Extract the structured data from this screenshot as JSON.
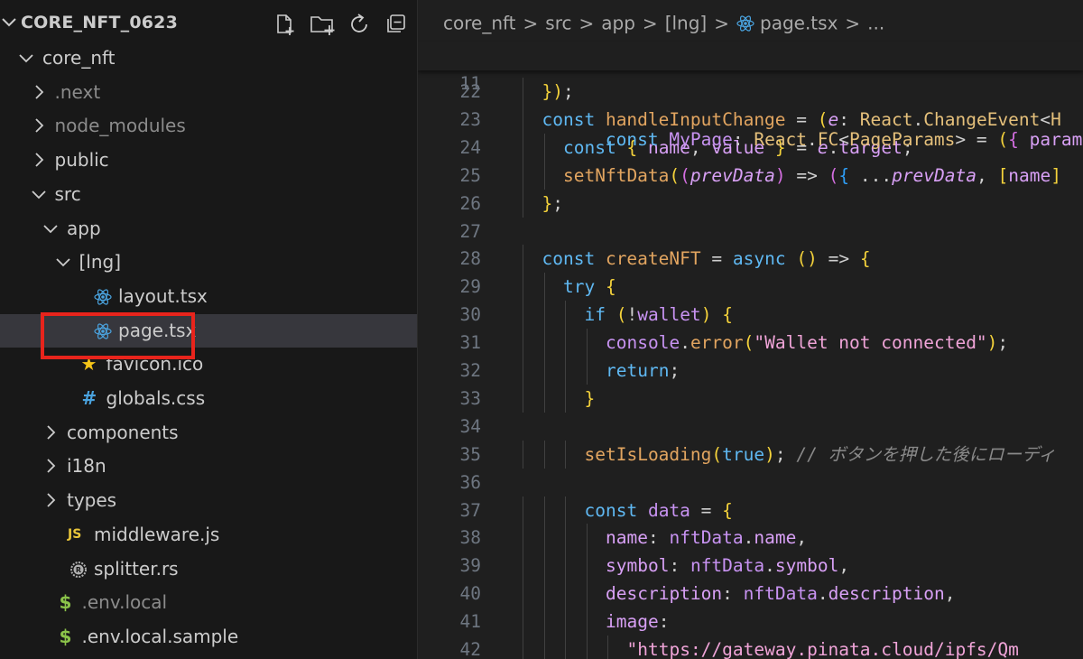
{
  "explorer": {
    "root_title": "CORE_NFT_0623",
    "header_actions": [
      "new-file",
      "new-folder",
      "refresh",
      "collapse-all"
    ],
    "items": [
      {
        "label": "core_nft",
        "type": "folder",
        "expanded": true,
        "indent": 1,
        "dim": false
      },
      {
        "label": ".next",
        "type": "folder",
        "expanded": false,
        "indent": 2,
        "dim": true
      },
      {
        "label": "node_modules",
        "type": "folder",
        "expanded": false,
        "indent": 2,
        "dim": true
      },
      {
        "label": "public",
        "type": "folder",
        "expanded": false,
        "indent": 2,
        "dim": false
      },
      {
        "label": "src",
        "type": "folder",
        "expanded": true,
        "indent": 2,
        "dim": false
      },
      {
        "label": "app",
        "type": "folder",
        "expanded": true,
        "indent": 3,
        "dim": false
      },
      {
        "label": "[lng]",
        "type": "folder",
        "expanded": true,
        "indent": 4,
        "dim": false
      },
      {
        "label": "layout.tsx",
        "type": "react-file",
        "indent": 5,
        "dim": false
      },
      {
        "label": "page.tsx",
        "type": "react-file",
        "indent": 5,
        "dim": false,
        "selected": true
      },
      {
        "label": "favicon.ico",
        "type": "star-file",
        "indent": 4,
        "dim": false
      },
      {
        "label": "globals.css",
        "type": "css-file",
        "indent": 4,
        "dim": false
      },
      {
        "label": "components",
        "type": "folder",
        "expanded": false,
        "indent": 3,
        "dim": false
      },
      {
        "label": "i18n",
        "type": "folder",
        "expanded": false,
        "indent": 3,
        "dim": false
      },
      {
        "label": "types",
        "type": "folder",
        "expanded": false,
        "indent": 3,
        "dim": false
      },
      {
        "label": "middleware.js",
        "type": "js-file",
        "indent": 3,
        "dim": false
      },
      {
        "label": "splitter.rs",
        "type": "rust-file",
        "indent": 3,
        "dim": false
      },
      {
        "label": ".env.local",
        "type": "env-file",
        "indent": 2,
        "dim": true
      },
      {
        "label": ".env.local.sample",
        "type": "env-file",
        "indent": 2,
        "dim": false
      }
    ],
    "icon_glyphs": {
      "js-file": "JS",
      "css-file": "#",
      "env-file": "$",
      "star-file": "★"
    }
  },
  "breadcrumb": {
    "segments": [
      "core_nft",
      "src",
      "app",
      "[lng]",
      "page.tsx",
      "..."
    ],
    "separator": ">"
  },
  "editor": {
    "sticky_line": {
      "number": "11",
      "code": "const MyPage: React.FC<PageParams> = ({ params: { l"
    },
    "lines": [
      {
        "number": "22",
        "code": "  });"
      },
      {
        "number": "23",
        "code": "  const handleInputChange = (e: React.ChangeEvent<H"
      },
      {
        "number": "24",
        "code": "    const { name, value } = e.target;"
      },
      {
        "number": "25",
        "code": "    setNftData((prevData) => ({ ...prevData, [name]"
      },
      {
        "number": "26",
        "code": "  };"
      },
      {
        "number": "27",
        "code": ""
      },
      {
        "number": "28",
        "code": "  const createNFT = async () => {"
      },
      {
        "number": "29",
        "code": "    try {"
      },
      {
        "number": "30",
        "code": "      if (!wallet) {"
      },
      {
        "number": "31",
        "code": "        console.error(\"Wallet not connected\");"
      },
      {
        "number": "32",
        "code": "        return;"
      },
      {
        "number": "33",
        "code": "      }"
      },
      {
        "number": "34",
        "code": ""
      },
      {
        "number": "35",
        "code": "      setIsLoading(true); // ボタンを押した後にローディ"
      },
      {
        "number": "36",
        "code": ""
      },
      {
        "number": "37",
        "code": "      const data = {"
      },
      {
        "number": "38",
        "code": "        name: nftData.name,"
      },
      {
        "number": "39",
        "code": "        symbol: nftData.symbol,"
      },
      {
        "number": "40",
        "code": "        description: nftData.description,"
      },
      {
        "number": "41",
        "code": "        image:"
      },
      {
        "number": "42",
        "code": "          \"https://gateway.pinata.cloud/ipfs/Qm"
      }
    ]
  },
  "colors": {
    "highlight_box": "#e8241c",
    "selected_row": "#37373d",
    "react_icon": "#4aa3df",
    "js_icon": "#e8c53a",
    "css_icon": "#4aa3df",
    "env_icon": "#8bc34a",
    "star_icon": "#f5c518"
  }
}
